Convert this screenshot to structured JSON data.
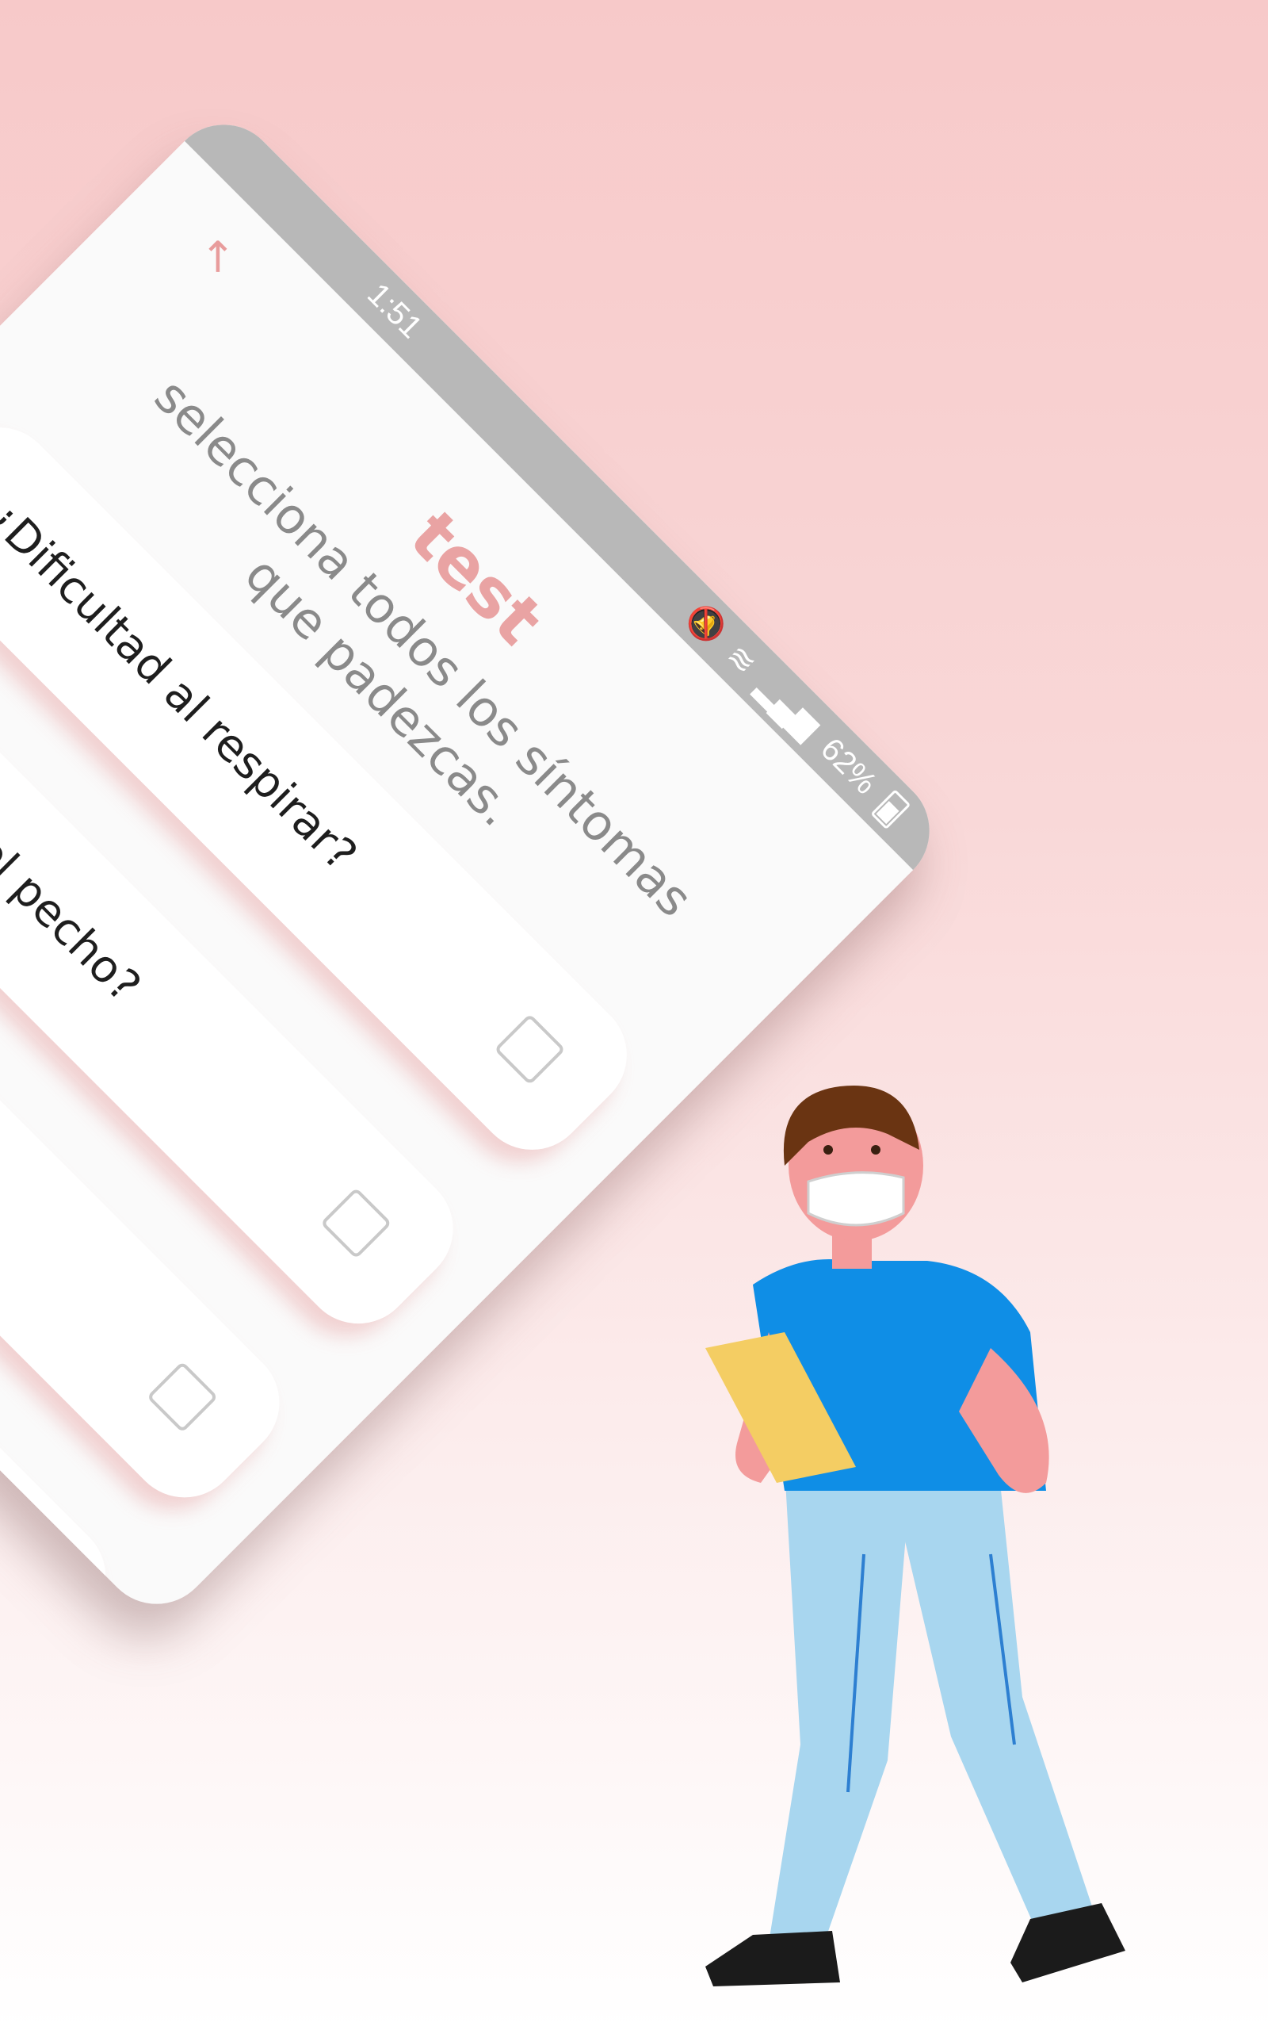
{
  "status_bar": {
    "time": "1:51",
    "battery": "62%"
  },
  "header": {
    "title": "test",
    "subtitle": "selecciona todos los síntomas que padezcas."
  },
  "symptoms": [
    {
      "label": "¿Dificultad al respirar?"
    },
    {
      "label": "¿Dolor en el pecho?"
    },
    {
      "label": ""
    },
    {
      "label": ""
    }
  ],
  "illustration": {
    "icon": "health-worker-illustration"
  }
}
